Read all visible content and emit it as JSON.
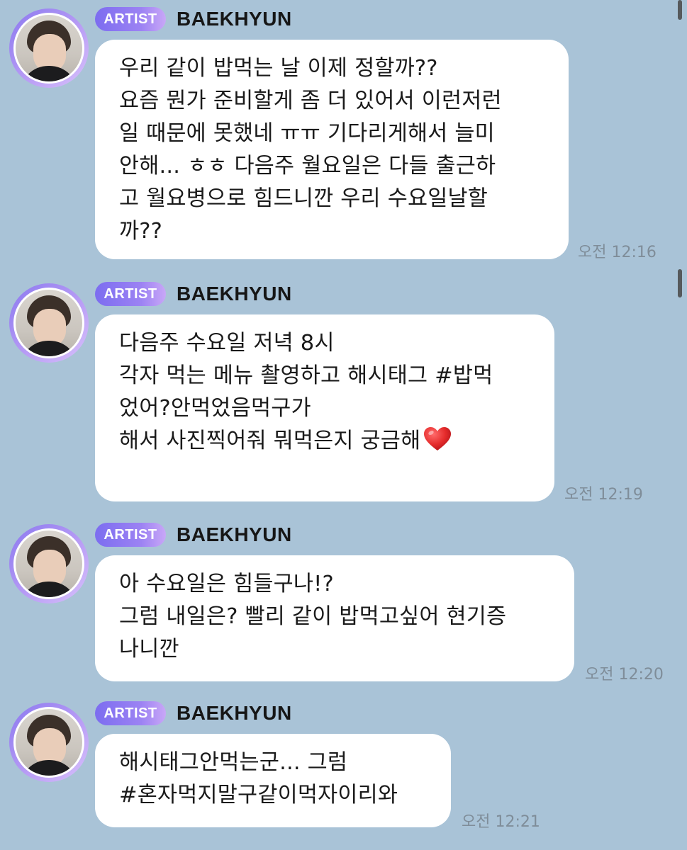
{
  "messages": [
    {
      "badge": "ARTIST",
      "sender": "BAEKHYUN",
      "lines": [
        "우리 같이 밥먹는 날 이제 정할까??",
        "요즘 뭔가 준비할게 좀 더 있어서 이런저런",
        "일 때문에 못했네 ㅠㅠ 기다리게해서 늘미",
        "안해... ㅎㅎ 다음주 월요일은 다들 출근하",
        "고 월요병으로 힘드니깐 우리 수요일날할",
        "까??"
      ],
      "time": "오전 12:16"
    },
    {
      "badge": "ARTIST",
      "sender": "BAEKHYUN",
      "lines": [
        "다음주 수요일 저녁 8시",
        "각자 먹는 메뉴 촬영하고 해시태그 #밥먹",
        "었어?안먹었음먹구가",
        "해서 사진찍어줘 뭐먹은지 궁금해"
      ],
      "emoji": "heart-emoji",
      "time": "오전 12:19"
    },
    {
      "badge": "ARTIST",
      "sender": "BAEKHYUN",
      "lines": [
        "아 수요일은 힘들구나!?",
        "그럼 내일은? 빨리 같이 밥먹고싶어 현기증",
        "나니깐"
      ],
      "time": "오전 12:20"
    },
    {
      "badge": "ARTIST",
      "sender": "BAEKHYUN",
      "lines": [
        "해시태그안먹는군... 그럼",
        "#혼자먹지말구같이먹자이리와"
      ],
      "time": "오전 12:21"
    }
  ],
  "colors": {
    "background": "#a9c3d7",
    "bubble": "#ffffff",
    "badge_start": "#7c6df0",
    "badge_end": "#c9a7f7",
    "timestamp": "#7f8d99",
    "heart": "#e52b2b"
  }
}
